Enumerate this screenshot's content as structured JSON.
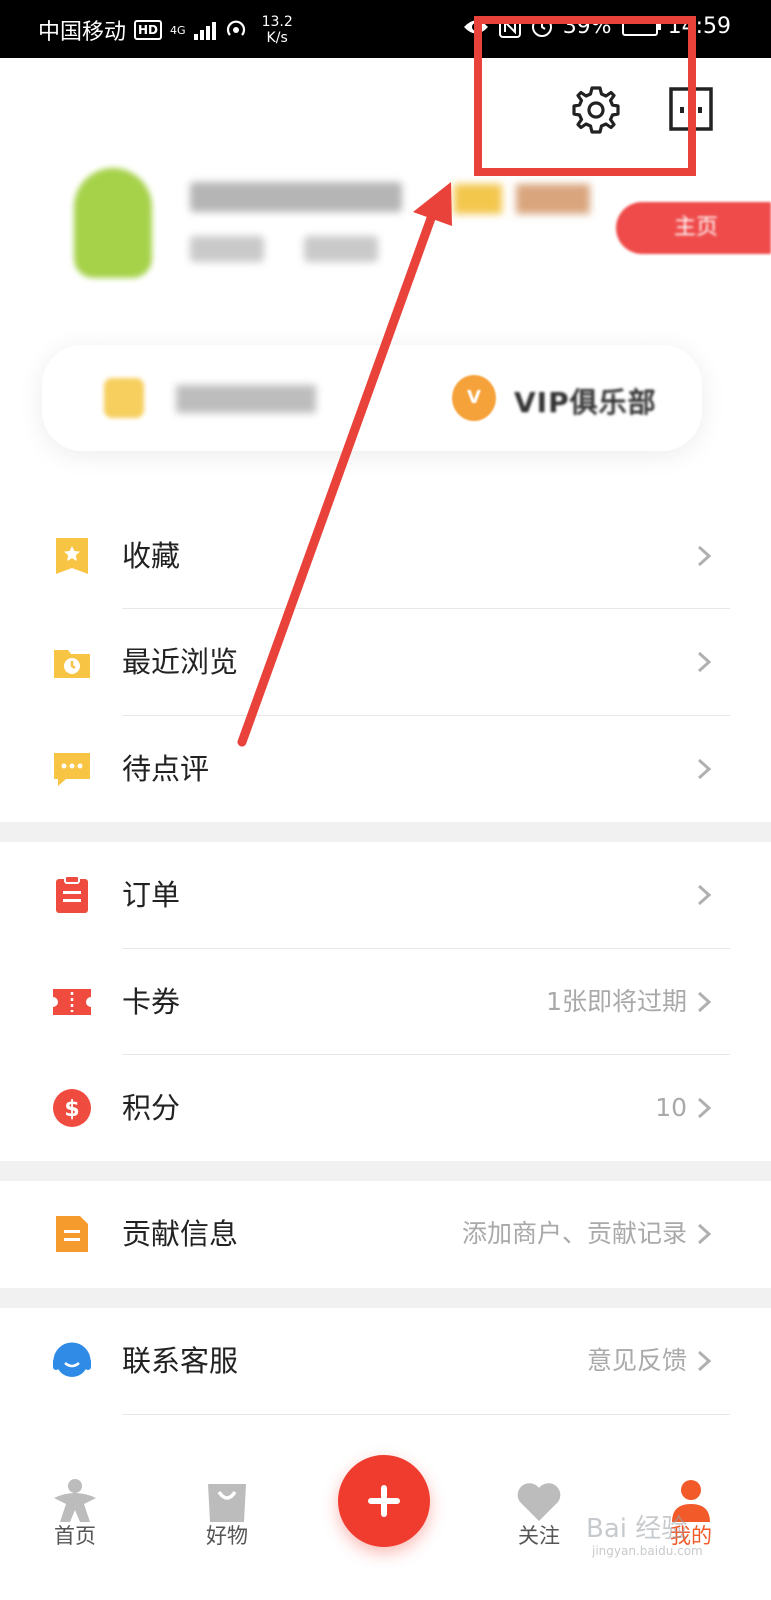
{
  "status_bar": {
    "carrier": "中国移动",
    "hd": "HD",
    "network": "4G",
    "speed_value": "13.2",
    "speed_unit": "K/s",
    "battery": "39%",
    "time": "14:59"
  },
  "menu": {
    "group1": [
      {
        "label": "收藏",
        "right": ""
      },
      {
        "label": "最近浏览",
        "right": ""
      },
      {
        "label": "待点评",
        "right": ""
      }
    ],
    "group2": [
      {
        "label": "订单",
        "right": ""
      },
      {
        "label": "卡券",
        "right": "1张即将过期"
      },
      {
        "label": "积分",
        "right": "10"
      }
    ],
    "group3": [
      {
        "label": "贡献信息",
        "right": "添加商户、贡献记录"
      }
    ],
    "group4": [
      {
        "label": "联系客服",
        "right": "意见反馈"
      }
    ]
  },
  "membership": {
    "vip_label": "VIP俱乐部",
    "vip_icon_text": "V"
  },
  "bottom_nav": [
    {
      "label": "首页",
      "icon": "home-person-icon"
    },
    {
      "label": "好物",
      "icon": "shopping-bag-icon"
    },
    {
      "label": "",
      "icon": "plus-icon"
    },
    {
      "label": "关注",
      "icon": "heart-icon"
    },
    {
      "label": "我的",
      "icon": "user-icon"
    }
  ],
  "watermark": {
    "text": "Bai 经验",
    "sub": "jingyan.baidu.com"
  },
  "colors": {
    "accent": "#f03b2f",
    "annotation": "#e8423a",
    "icon_yellow": "#f7c443",
    "icon_red": "#ef4b3f"
  }
}
